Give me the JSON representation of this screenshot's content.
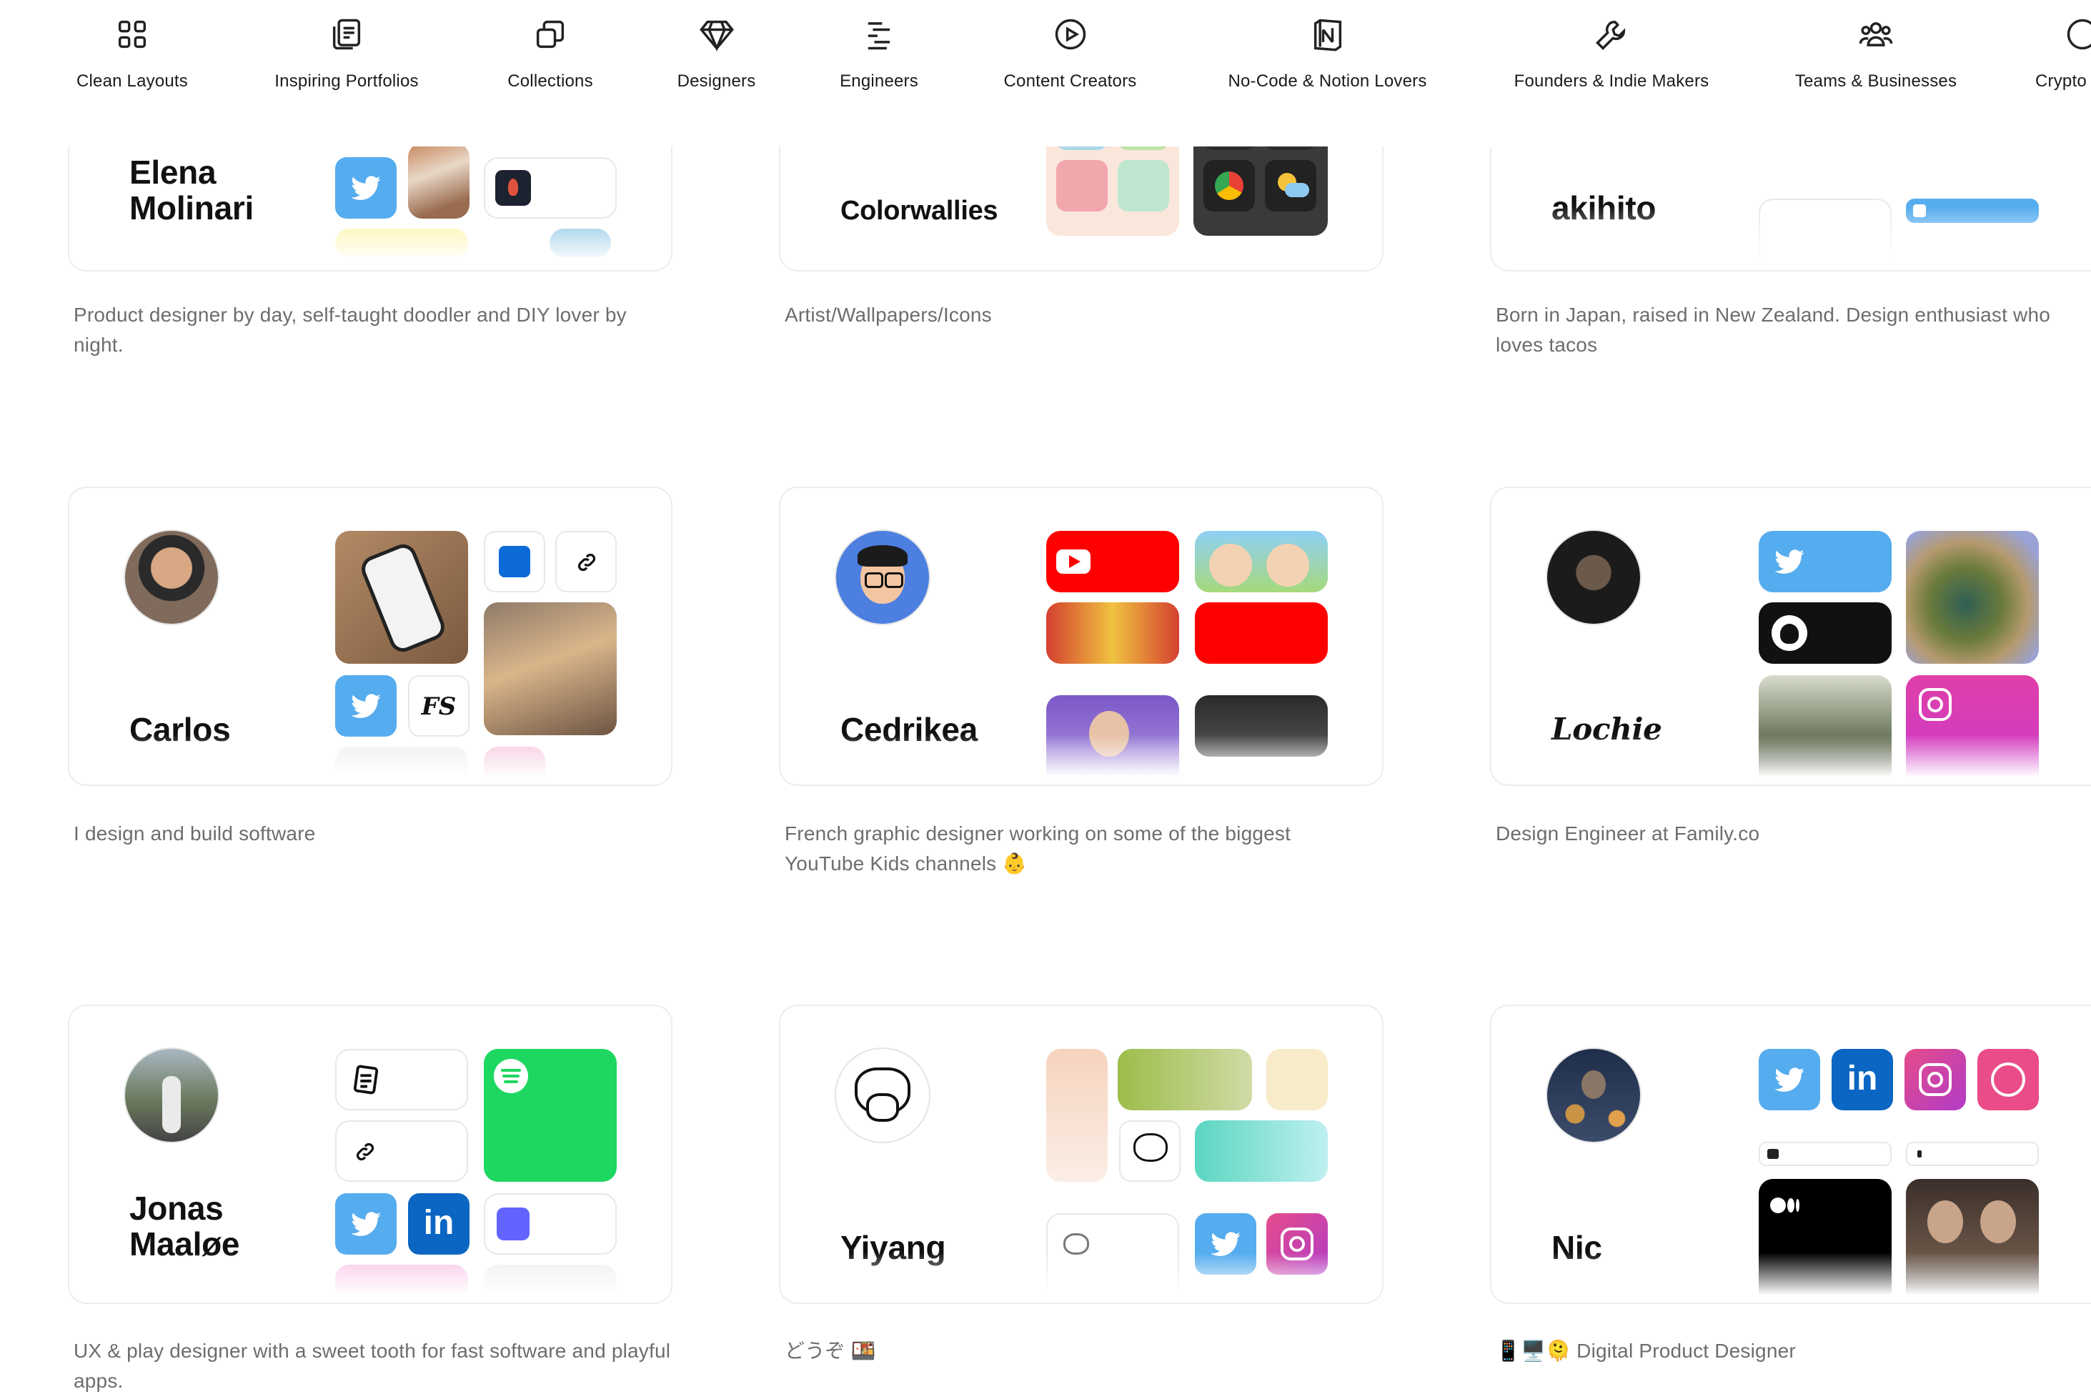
{
  "nav": {
    "items": [
      {
        "label": "Clean Layouts",
        "icon": "grid-icon"
      },
      {
        "label": "Inspiring Portfolios",
        "icon": "portfolio-icon"
      },
      {
        "label": "Collections",
        "icon": "collections-icon"
      },
      {
        "label": "Designers",
        "icon": "diamond-icon"
      },
      {
        "label": "Engineers",
        "icon": "code-lines-icon"
      },
      {
        "label": "Content Creators",
        "icon": "play-circle-icon"
      },
      {
        "label": "No-Code & Notion Lovers",
        "icon": "notion-icon"
      },
      {
        "label": "Founders & Indie Makers",
        "icon": "wrench-icon"
      },
      {
        "label": "Teams & Businesses",
        "icon": "team-icon"
      },
      {
        "label": "Crypto",
        "icon": "crypto-icon"
      }
    ]
  },
  "profiles": [
    {
      "name": "Elena Molinari",
      "bio": "Product designer by day, self-taught doodler and DIY lover by night."
    },
    {
      "name": "Colorwallies",
      "bio": "Artist/Wallpapers/Icons"
    },
    {
      "name": "akihito",
      "bio": "Born in Japan, raised in New Zealand. Design enthusiast who loves tacos"
    },
    {
      "name": "Carlos",
      "bio": "I design and build software"
    },
    {
      "name": "Cedrikea",
      "bio": "French graphic designer working on some of the biggest YouTube Kids channels 👶"
    },
    {
      "name": "Lochie",
      "bio": "Design Engineer at Family.co"
    },
    {
      "name": "Jonas Maaløe",
      "bio": "UX & play designer with a sweet tooth for fast software and playful apps."
    },
    {
      "name": "Yiyang",
      "bio": "どうぞ 🍱"
    },
    {
      "name": "Nic",
      "bio": "📱🖥️🫠 Digital Product Designer"
    }
  ],
  "colors": {
    "twitter": "#55acee",
    "linkedin": "#0a66c2",
    "instagram": "#e1306c",
    "dribbble": "#ea4c89",
    "youtube": "#ff0000",
    "spotify": "#1ed760",
    "mastodon": "#6364ff",
    "github": "#111111",
    "text_muted": "#6d6d6d"
  }
}
